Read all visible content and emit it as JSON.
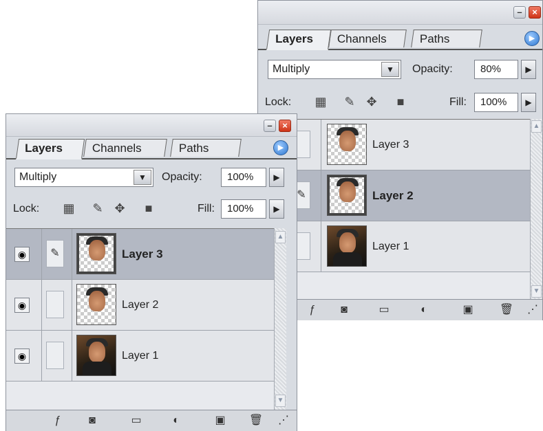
{
  "panel_back": {
    "tabs": [
      "Layers",
      "Channels",
      "Paths"
    ],
    "blend_mode": "Multiply",
    "opacity_label": "Opacity:",
    "opacity_value": "80%",
    "lock_label": "Lock:",
    "fill_label": "Fill:",
    "fill_value": "100%",
    "layers": [
      {
        "name": "Layer 3"
      },
      {
        "name": "Layer 2"
      },
      {
        "name": "Layer 1"
      }
    ]
  },
  "panel_front": {
    "tabs": [
      "Layers",
      "Channels",
      "Paths"
    ],
    "blend_mode": "Multiply",
    "opacity_label": "Opacity:",
    "opacity_value": "100%",
    "lock_label": "Lock:",
    "fill_label": "Fill:",
    "fill_value": "100%",
    "layers": [
      {
        "name": "Layer 3"
      },
      {
        "name": "Layer 2"
      },
      {
        "name": "Layer 1"
      }
    ]
  },
  "colors": {
    "panel_bg": "#d8dce2",
    "selected_row": "#b3b8c3",
    "close_button": "#cf3418",
    "menu_button": "#2f77d0"
  },
  "icons": [
    "minimize-icon",
    "close-icon",
    "panel-menu-icon",
    "dropdown-arrow-icon",
    "step-arrow-icon",
    "lock-transparent-icon",
    "lock-paint-icon",
    "lock-move-icon",
    "lock-all-icon",
    "eye-icon",
    "brush-icon",
    "link-layers-icon",
    "layer-style-icon",
    "layer-mask-icon",
    "new-group-icon",
    "adjustment-layer-icon",
    "new-layer-icon",
    "trash-icon",
    "resize-grip-icon"
  ]
}
